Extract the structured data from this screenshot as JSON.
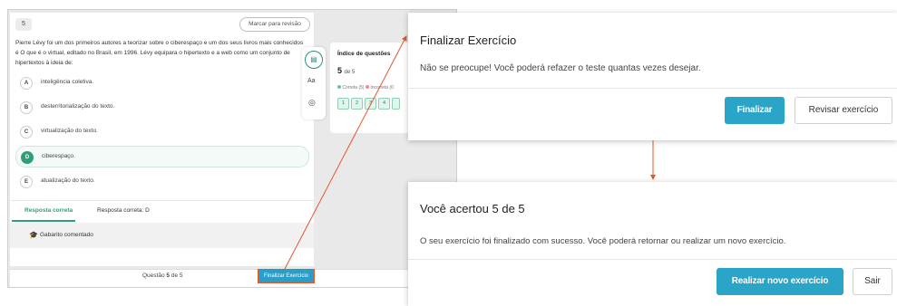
{
  "question": {
    "number": "5",
    "review_label": "Marcar para revisão",
    "text": "Pierre Lévy foi um dos primeiros autores a teorizar sobre o ciberespaço e um dos seus livros mais conhecidos é O que é o virtual, editado no Brasil, em 1996. Lévy equipara o hipertexto e a web como um conjunto de hipertextos à ideia de:",
    "options": [
      {
        "letter": "A",
        "text": "inteligência coletiva."
      },
      {
        "letter": "B",
        "text": "desterritorialização do texto."
      },
      {
        "letter": "C",
        "text": "virtualização do texto."
      },
      {
        "letter": "D",
        "text": "ciberespaço."
      },
      {
        "letter": "E",
        "text": "atualização do texto."
      }
    ],
    "selected": "D"
  },
  "answer": {
    "tab_label": "Resposta correta",
    "correct_text": "Resposta correta: D",
    "gabarito_label": "Gabarito comentado"
  },
  "tools": {
    "font_label": "Aa"
  },
  "index": {
    "title": "Índice de questões",
    "count": "5",
    "count_suffix": "de 5",
    "legend_correct": "Correta (5)",
    "legend_incorrect": "Incorreta (0",
    "boxes": [
      "1",
      "2",
      "3",
      "4"
    ]
  },
  "footer": {
    "question_label": "Questão",
    "question_current": "5",
    "question_total_text": "de 5",
    "finalize_label": "Finalizar Exercício"
  },
  "modal_finalize": {
    "title": "Finalizar Exercício",
    "message": "Não se preocupe! Você poderá refazer o teste quantas vezes desejar.",
    "primary_label": "Finalizar",
    "secondary_label": "Revisar exercício"
  },
  "modal_result": {
    "title": "Você acertou 5 de 5",
    "message": "O seu exercício foi finalizado com sucesso. Você poderá retornar ou realizar um novo exercício.",
    "primary_label": "Realizar novo exercício",
    "secondary_label": "Sair"
  },
  "colors": {
    "accent_blue": "#2aa4c7",
    "correct_green": "#2f9e77",
    "arrow_orange": "#e4572e"
  },
  "icons": [
    "book-icon",
    "font-size-icon",
    "target-icon",
    "graduation-cap-icon"
  ]
}
